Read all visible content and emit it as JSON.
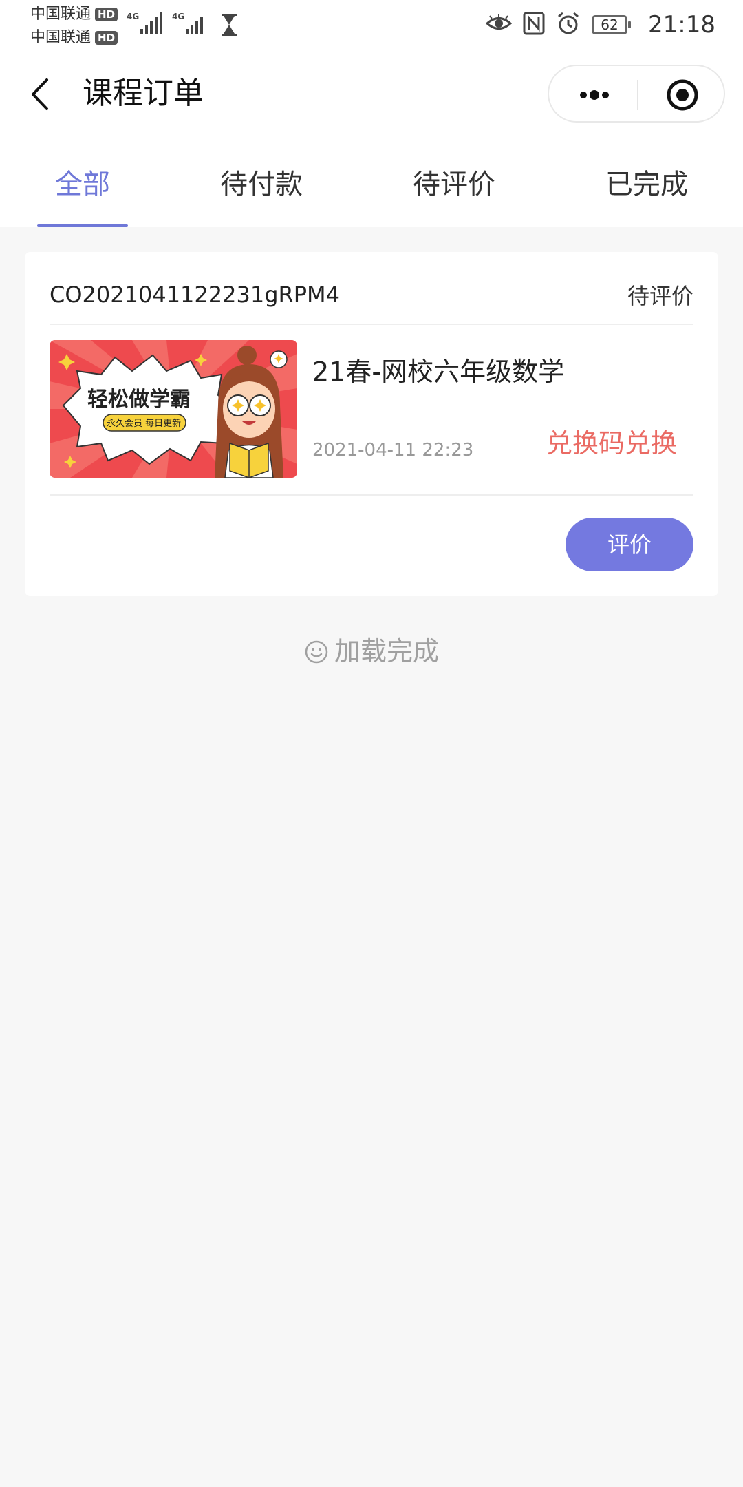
{
  "status_bar": {
    "carrier1": "中国联通",
    "carrier2": "中国联通",
    "hd_badge": "HD",
    "network1": "4G",
    "network2": "4G",
    "battery": "62",
    "time": "21:18",
    "icons": [
      "hourglass-icon",
      "eye-icon",
      "nfc-icon",
      "alarm-icon",
      "battery-icon"
    ]
  },
  "header": {
    "title": "课程订单",
    "icons": [
      "back-icon",
      "more-icon",
      "close-target-icon"
    ]
  },
  "tabs": [
    {
      "label": "全部",
      "active": true
    },
    {
      "label": "待付款",
      "active": false
    },
    {
      "label": "待评价",
      "active": false
    },
    {
      "label": "已完成",
      "active": false
    }
  ],
  "order": {
    "order_no": "CO2021041122231gRPM4",
    "status": "待评价",
    "course": {
      "thumbnail_title": "轻松做学霸",
      "thumbnail_badge": "永久会员 每日更新",
      "title": "21春-网校六年级数学",
      "date": "2021-04-11 22:23",
      "price_text": "兑换码兑换"
    },
    "review_button": "评价"
  },
  "footer": {
    "loaded_text": "加载完成"
  },
  "colors": {
    "accent": "#6f78d8",
    "button": "#7479e0",
    "price": "#ea6a63",
    "background": "#f7f7f7"
  }
}
